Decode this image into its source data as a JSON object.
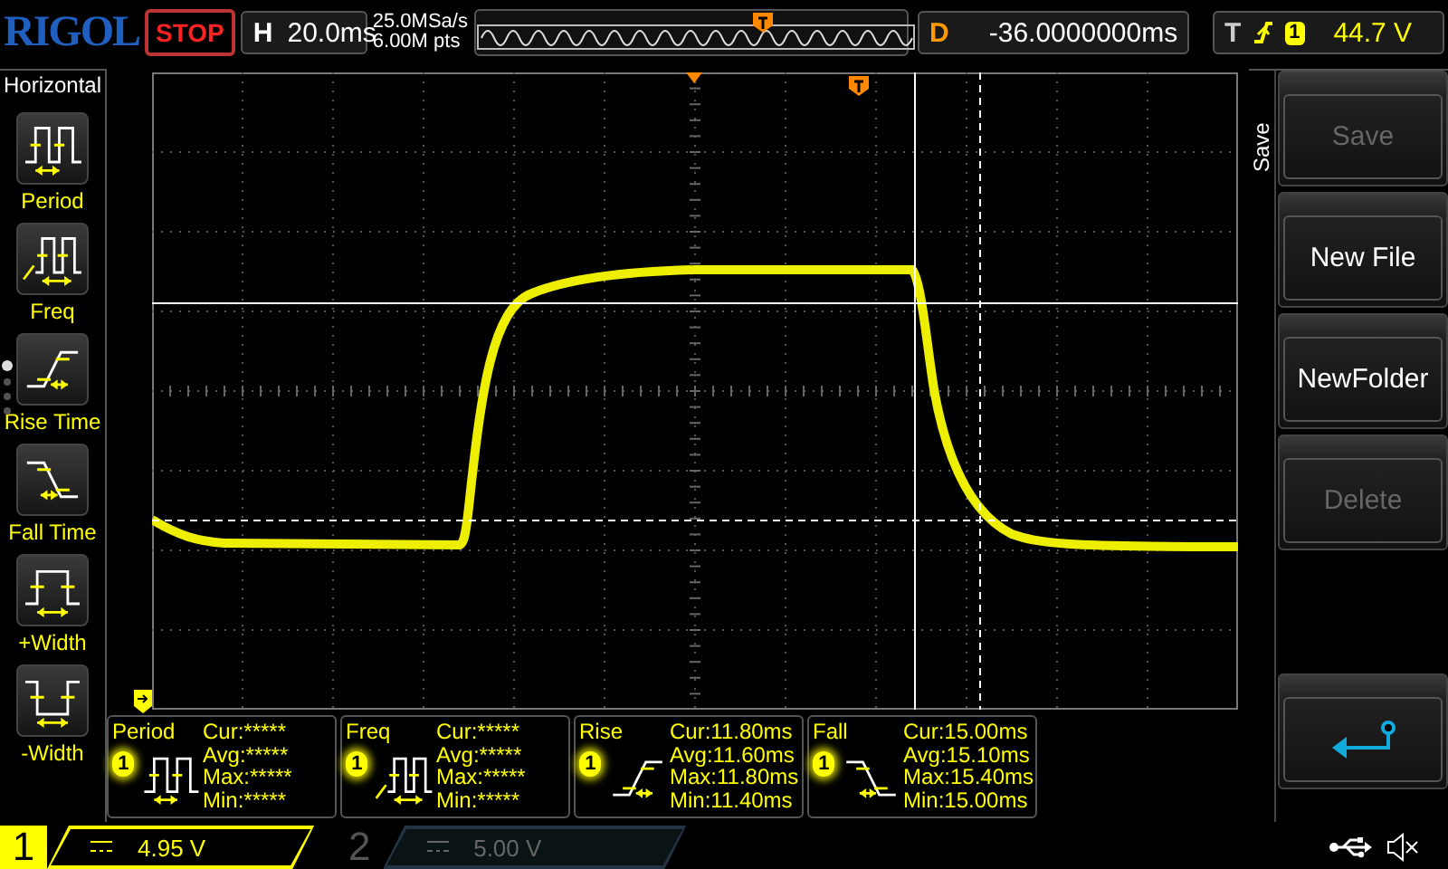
{
  "top_bar": {
    "logo": "RIGOL",
    "run_state": "STOP",
    "timebase": {
      "label": "H",
      "value": "20.0ms"
    },
    "sample_rate": "25.0MSa/s",
    "memory_depth": "6.00M pts",
    "delay": {
      "label": "D",
      "value": "-36.0000000ms"
    },
    "trigger": {
      "label": "T",
      "channel": "1",
      "level": "44.7 V"
    }
  },
  "left_menu": {
    "title": "Horizontal",
    "items": [
      {
        "label": "Period",
        "kind": "period"
      },
      {
        "label": "Freq",
        "kind": "freq"
      },
      {
        "label": "Rise Time",
        "kind": "rise"
      },
      {
        "label": "Fall Time",
        "kind": "fall"
      },
      {
        "label": "+Width",
        "kind": "pwidth"
      },
      {
        "label": "-Width",
        "kind": "nwidth"
      }
    ],
    "pages": [
      {
        "selected": true
      },
      {
        "selected": false
      },
      {
        "selected": false
      },
      {
        "selected": false
      }
    ]
  },
  "measurements": [
    {
      "name": "Period",
      "channel": "1",
      "kind": "period",
      "lines": [
        "Cur:*****",
        "Avg:*****",
        "Max:*****",
        "Min:*****"
      ]
    },
    {
      "name": "Freq",
      "channel": "1",
      "kind": "freq",
      "lines": [
        "Cur:*****",
        "Avg:*****",
        "Max:*****",
        "Min:*****"
      ]
    },
    {
      "name": "Rise",
      "channel": "1",
      "kind": "rise",
      "lines": [
        "Cur:11.80ms",
        "Avg:11.60ms",
        "Max:11.80ms",
        "Min:11.40ms"
      ]
    },
    {
      "name": "Fall",
      "channel": "1",
      "kind": "fall",
      "lines": [
        "Cur:15.00ms",
        "Avg:15.10ms",
        "Max:15.40ms",
        "Min:15.00ms"
      ]
    }
  ],
  "right_menu": {
    "title": "Save",
    "buttons": [
      {
        "kind": "text",
        "label": "Save",
        "disabled": true
      },
      {
        "kind": "text",
        "label": "New File",
        "disabled": false
      },
      {
        "kind": "text",
        "label": "NewFolder",
        "disabled": false
      },
      {
        "kind": "text",
        "label": "Delete",
        "disabled": true
      },
      {
        "kind": "return"
      }
    ]
  },
  "channels": [
    {
      "number": "1",
      "value": "4.95 V",
      "on": true
    },
    {
      "number": "2",
      "value": "5.00 V",
      "on": false
    }
  ]
}
